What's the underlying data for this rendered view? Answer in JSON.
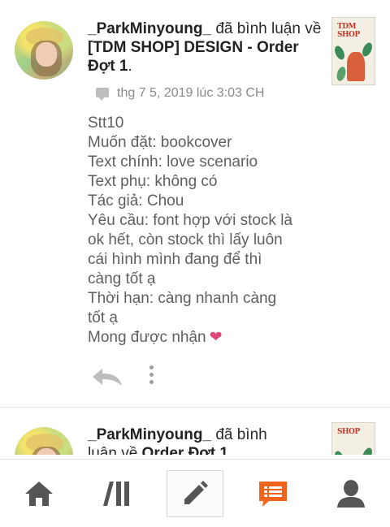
{
  "notifications": [
    {
      "username": "_ParkMinyoung_",
      "action_text": " đã bình luận về ",
      "target": "[TDM SHOP] DESIGN - Order Đợt 1",
      "end": ".",
      "timestamp": "thg 7 5, 2019 lúc 3:03 CH",
      "comment_lines": [
        "Stt10",
        "Muốn đặt: bookcover",
        "Text chính: love scenario",
        "Text phụ: không có",
        "Tác giả: Chou",
        "Yêu cầu: font hợp với stock là",
        "ok hết, còn stock thì lấy luôn",
        "cái hình mình đang để thì",
        "càng tốt ạ",
        "Thời hạn: càng nhanh càng",
        "tốt ạ",
        "Mong được nhận"
      ],
      "heart": "❤",
      "thumb_text": "TDM SHOP"
    },
    {
      "username": "_ParkMinyoung_",
      "action_text": " đã bình",
      "line2": "luận về ",
      "target": "Order Đợt 1",
      "thumb_text": "SHOP"
    }
  ],
  "bottom_nav": {
    "icons": [
      "home-icon",
      "library-icon",
      "pencil-icon",
      "notifications-icon",
      "profile-icon"
    ],
    "active": "notifications-icon",
    "active_color": "#f2641c",
    "inactive_color": "#555555"
  }
}
